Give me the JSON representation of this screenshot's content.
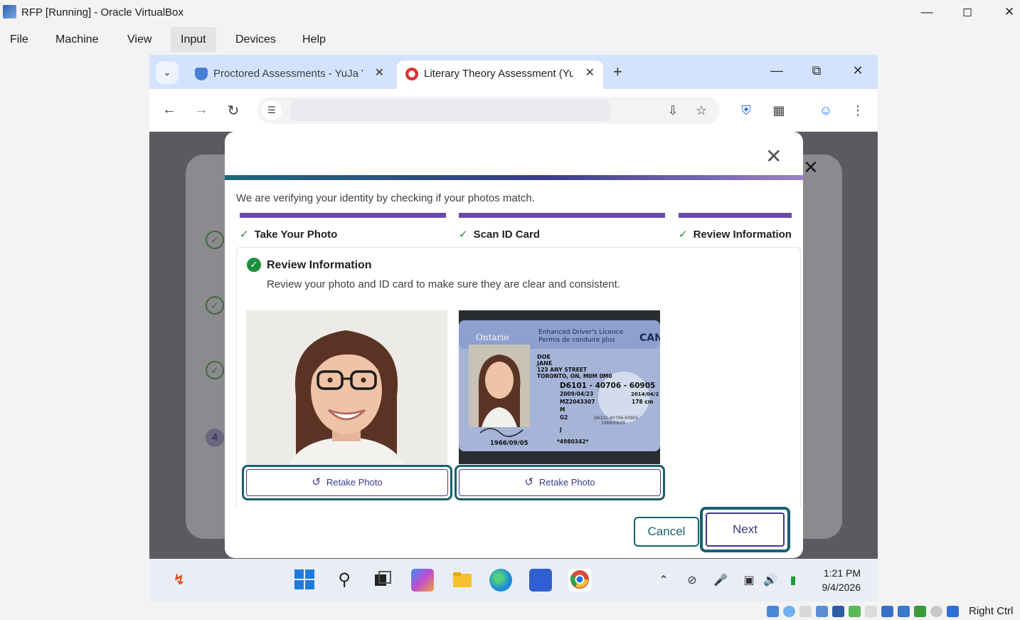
{
  "host": {
    "title": "RFP [Running] - Oracle VirtualBox",
    "menu": [
      "File",
      "Machine",
      "View",
      "Input",
      "Devices",
      "Help"
    ],
    "active_menu": "Input",
    "status": {
      "right_ctrl": "Right Ctrl"
    }
  },
  "browser": {
    "tabs": [
      {
        "label": "Proctored Assessments - YuJa V",
        "icon": "shield-icon",
        "active": false
      },
      {
        "label": "Literary Theory Assessment (Yu",
        "icon": "canvas-icon",
        "active": true
      }
    ],
    "address": ""
  },
  "background": {
    "step_number": "4"
  },
  "modal": {
    "intro": "We are verifying your identity by checking if your photos match.",
    "steps": [
      {
        "label": "Take Your Photo",
        "done": true
      },
      {
        "label": "Scan ID Card",
        "done": true
      },
      {
        "label": "Review Information",
        "done": true
      }
    ],
    "review": {
      "title": "Review Information",
      "description": "Review your photo and ID card to make sure they are clear and consistent."
    },
    "id_card": {
      "province": "Ontario",
      "licence_en": "Enhanced Driver's Licence",
      "licence_fr": "Permis de conduire plus",
      "country": "CAN",
      "surname": "DOE",
      "given": "JANE",
      "address1": "123 ANY STREET",
      "address2": "TORONTO, ON, M0M 0M0",
      "number": "D6101 - 40706 - 60905",
      "issued": "2009/04/23",
      "expiry": "2014/04/2",
      "ref": "MZ2043307",
      "height": "178 cm",
      "sex": "M",
      "class": "G2",
      "restrictions": "J",
      "dob": "1966/09/05",
      "barcode_no": "*4980342*",
      "side_number": "D6101-40706-60905",
      "side_date": "1966/09/05"
    },
    "buttons": {
      "retake_photo": "Retake Photo",
      "retake_id": "Retake Photo",
      "cancel": "Cancel",
      "next": "Next"
    }
  },
  "taskbar": {
    "time": "1:21 PM",
    "date": "9/4/2026"
  }
}
